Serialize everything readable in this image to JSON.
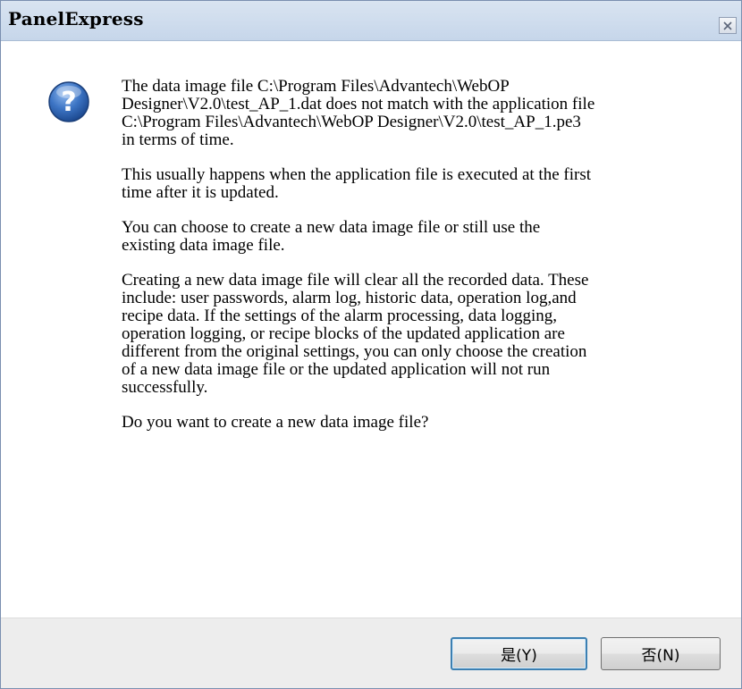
{
  "window": {
    "title": "PanelExpress",
    "close_icon": "close-icon"
  },
  "icon": {
    "name": "question-icon",
    "glyph": "?",
    "color": "#2a5fa8"
  },
  "message": {
    "paragraphs": [
      "The data image file C:\\Program Files\\Advantech\\WebOP\nDesigner\\V2.0\\test_AP_1.dat does not match with the application file\nC:\\Program Files\\Advantech\\WebOP Designer\\V2.0\\test_AP_1.pe3\nin terms of time.",
      "This usually happens when the application file is executed at the first\ntime after it is updated.",
      "You can choose to create a new data image file or still use the\nexisting data image file.",
      "Creating a new data image file will clear all the recorded data. These\ninclude: user passwords, alarm log, historic data, operation log,and\nrecipe data. If the settings of the alarm processing, data logging,\noperation logging, or recipe blocks of the updated application are\ndifferent from the original settings, you can only choose the creation\nof a new data image file or the updated application will not run\nsuccessfully.",
      "Do you want to create a new data image file?"
    ]
  },
  "buttons": {
    "yes_label": "是(Y)",
    "no_label": "否(N)"
  },
  "colors": {
    "titlebar": "#c6d6ea",
    "footer": "#ededed",
    "default_button_border": "#3c7fb1"
  }
}
